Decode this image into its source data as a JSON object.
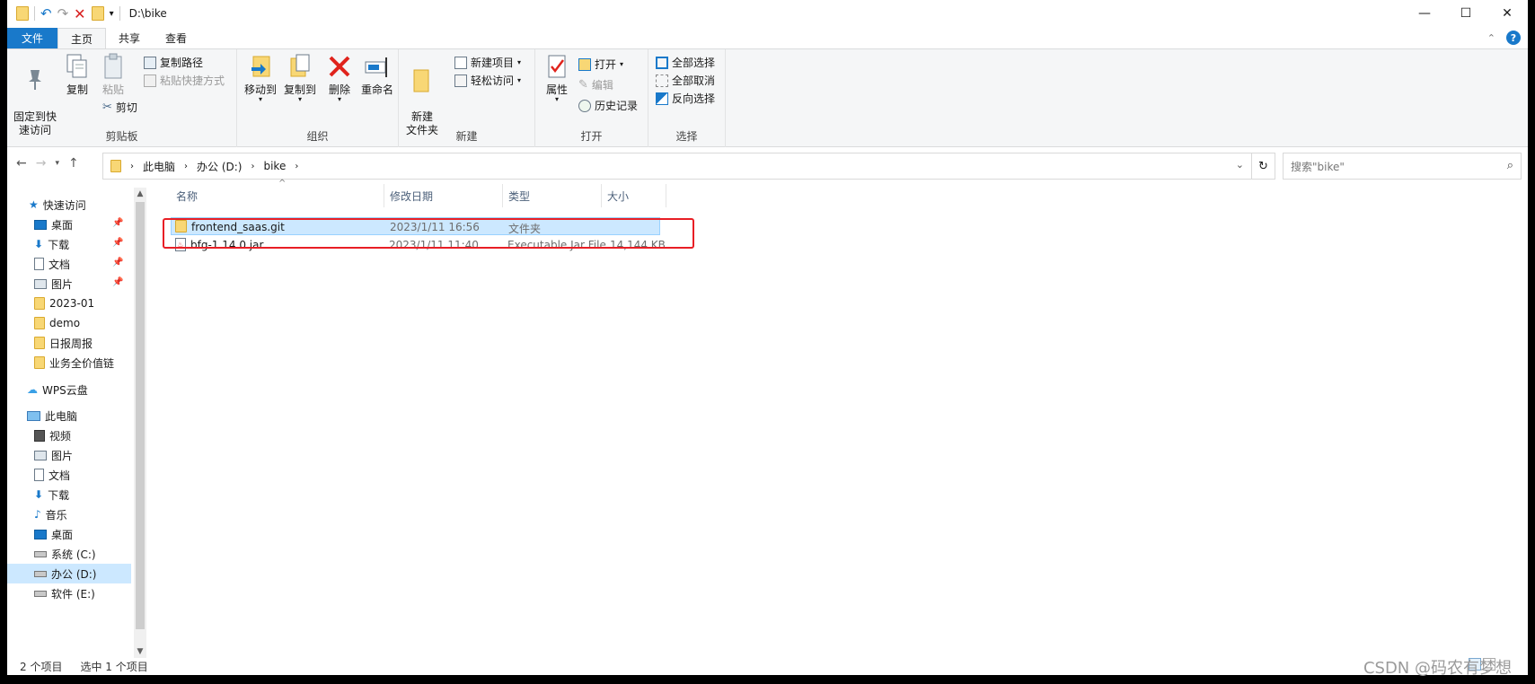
{
  "window": {
    "title": "D:\\bike",
    "controls": {
      "minimize": "—",
      "maximize": "☐",
      "close": "✕"
    }
  },
  "ribbon": {
    "tabs": [
      {
        "label": "文件"
      },
      {
        "label": "主页"
      },
      {
        "label": "共享"
      },
      {
        "label": "查看"
      }
    ],
    "clipboard": {
      "label": "剪贴板",
      "pin": "固定到快\n速访问",
      "copy": "复制",
      "paste": "粘贴",
      "copy_path": "复制路径",
      "paste_shortcut": "粘贴快捷方式",
      "cut": "剪切"
    },
    "organize": {
      "label": "组织",
      "move_to": "移动到",
      "copy_to": "复制到",
      "delete": "删除",
      "rename": "重命名"
    },
    "new": {
      "label": "新建",
      "new_folder": "新建\n文件夹",
      "new_item": "新建项目",
      "easy_access": "轻松访问"
    },
    "open": {
      "label": "打开",
      "properties": "属性",
      "open": "打开",
      "edit": "编辑",
      "history": "历史记录"
    },
    "select": {
      "label": "选择",
      "select_all": "全部选择",
      "select_none": "全部取消",
      "invert": "反向选择"
    }
  },
  "address": {
    "crumbs": [
      "此电脑",
      "办公 (D:)",
      "bike"
    ],
    "search_placeholder": "搜索\"bike\""
  },
  "nav": {
    "quick_access": "快速访问",
    "quick_items": [
      "桌面",
      "下载",
      "文档",
      "图片",
      "2023-01",
      "demo",
      "日报周报",
      "业务全价值链"
    ],
    "wps": "WPS云盘",
    "this_pc": "此电脑",
    "pc_items": [
      "视频",
      "图片",
      "文档",
      "下载",
      "音乐",
      "桌面",
      "系统 (C:)",
      "办公 (D:)",
      "软件 (E:)"
    ]
  },
  "columns": {
    "name": "名称",
    "date": "修改日期",
    "type": "类型",
    "size": "大小"
  },
  "files": [
    {
      "name": "frontend_saas.git",
      "date": "2023/1/11 16:56",
      "type": "文件夹",
      "size": ""
    },
    {
      "name": "bfg-1.14.0.jar",
      "date": "2023/1/11 11:40",
      "type": "Executable Jar File",
      "size": "14,144 KB"
    }
  ],
  "status": {
    "count": "2 个项目",
    "selected": "选中 1 个项目"
  },
  "watermark": "CSDN @码农有梦想",
  "colors": {
    "accent": "#1979ca",
    "selection": "#cce8ff",
    "highlight_box": "#e81e25"
  }
}
